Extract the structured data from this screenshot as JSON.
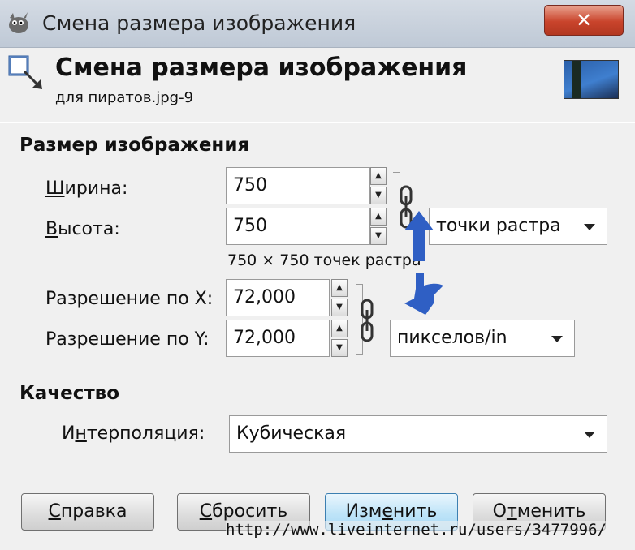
{
  "window": {
    "title": "Смена размера изображения",
    "close_label": "✕"
  },
  "header": {
    "title": "Смена размера изображения",
    "subtitle": "для пиратов.jpg-9"
  },
  "image_size": {
    "section_title": "Размер изображения",
    "width_label_hotkey": "Ш",
    "width_label_rest": "ирина:",
    "width_value": "750",
    "height_label_hotkey": "В",
    "height_label_rest": "ысота:",
    "height_value": "750",
    "size_unit": "точки растра",
    "size_info": "750 × 750 точек растра",
    "resolution_x_label": "Разрешение по X:",
    "resolution_x_value": "72,000",
    "resolution_y_label": "Разрешение по Y:",
    "resolution_y_value": "72,000",
    "resolution_unit": "пикселов/in"
  },
  "quality": {
    "section_title": "Качество",
    "interpolation_label_pre": "И",
    "interpolation_label_hotkey": "н",
    "interpolation_label_rest": "терполяция:",
    "interpolation_value": "Кубическая"
  },
  "buttons": {
    "help_hotkey": "С",
    "help_rest": "правка",
    "reset_hotkey": "С",
    "reset_rest": "бросить",
    "apply_pre": "Изм",
    "apply_hotkey": "е",
    "apply_rest": "нить",
    "cancel_pre": "О",
    "cancel_hotkey": "т",
    "cancel_rest": "менить"
  },
  "watermark": "http://www.liveinternet.ru/users/3477996/",
  "colors": {
    "annotation_arrow": "#2f5fc4"
  },
  "icons": {
    "app": "gimp-icon",
    "header": "resize-icon",
    "chain": "chain-link-icon"
  }
}
